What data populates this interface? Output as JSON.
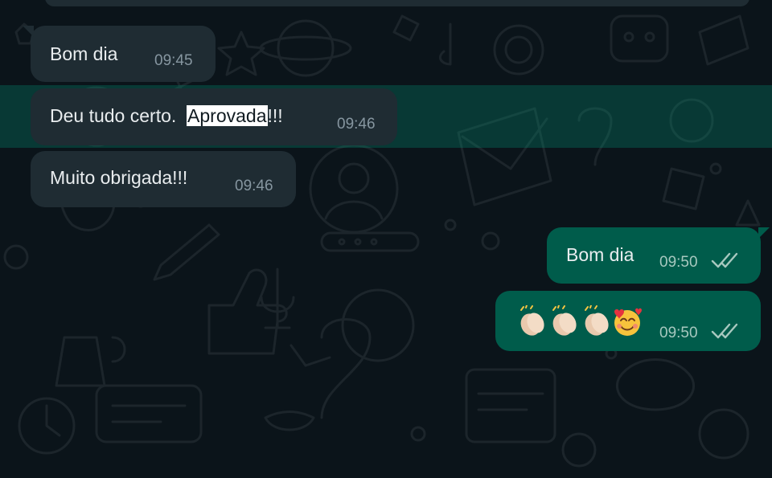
{
  "messages": [
    {
      "direction": "incoming",
      "text": "Bom dia",
      "time": "09:45"
    },
    {
      "direction": "incoming",
      "text_before": "Deu tudo certo.",
      "text_selected": "Aprovada",
      "text_after": "!!!",
      "time": "09:46",
      "selected": true
    },
    {
      "direction": "incoming",
      "text": "Muito obrigada!!!",
      "time": "09:46"
    },
    {
      "direction": "outgoing",
      "text": "Bom dia",
      "time": "09:50",
      "status": "read"
    },
    {
      "direction": "outgoing",
      "content": "emoji",
      "emoji_names": [
        "clapping-hands",
        "clapping-hands",
        "clapping-hands",
        "smiling-face-with-hearts"
      ],
      "time": "09:50",
      "status": "read"
    }
  ],
  "colors": {
    "background": "#0b141a",
    "incoming_bubble": "#1f2c33",
    "outgoing_bubble": "#005c4b",
    "selection_highlight": "#00a884",
    "text": "#e9edef",
    "timestamp": "#8696a0",
    "read_ticks": "#a7c8bf"
  }
}
